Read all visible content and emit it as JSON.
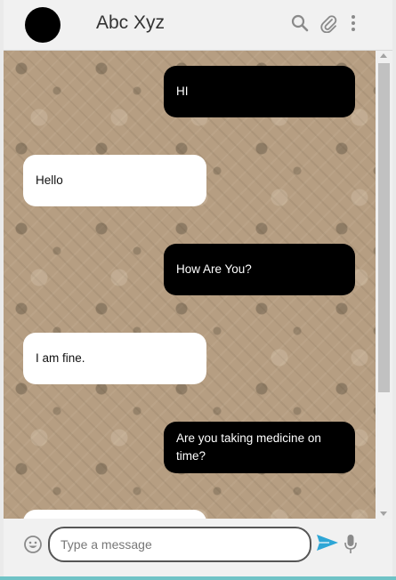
{
  "header": {
    "contact_name": "Abc Xyz",
    "icons": [
      "search-icon",
      "attachment-icon",
      "more-vert-icon"
    ]
  },
  "messages": [
    {
      "direction": "sent",
      "text": "HI"
    },
    {
      "direction": "received",
      "text": "Hello"
    },
    {
      "direction": "sent",
      "text": "How Are You?"
    },
    {
      "direction": "received",
      "text": "I am fine."
    },
    {
      "direction": "sent",
      "text": "Are you taking medicine on time?"
    }
  ],
  "composer": {
    "placeholder": "Type a message",
    "value": "",
    "icons": [
      "emoji-icon",
      "send-icon",
      "mic-icon"
    ]
  },
  "colors": {
    "sent_bubble": "#000000",
    "received_bubble": "#ffffff",
    "send_icon": "#2ea6d6",
    "chat_wallpaper": "#b69e82"
  }
}
